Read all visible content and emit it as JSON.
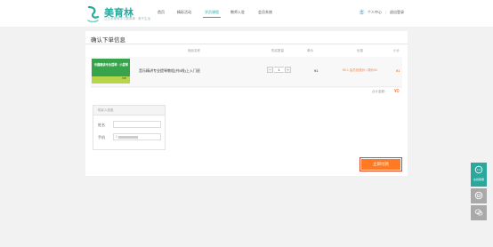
{
  "brand": {
    "name": "美育林",
    "slogan": "让艺术美育学习更简单 · 美于生活",
    "accent": "#2aa89e"
  },
  "nav": {
    "items": [
      {
        "label": "首页",
        "active": false
      },
      {
        "label": "精彩活动",
        "active": false
      },
      {
        "label": "学员课程",
        "active": true
      },
      {
        "label": "教师入驻",
        "active": false
      },
      {
        "label": "会员系统",
        "active": false
      }
    ]
  },
  "user": {
    "center": "个人中心",
    "separator": "|",
    "logout": "退出登录"
  },
  "order": {
    "title": "确认下单信息",
    "headers": {
      "name": "商品名称",
      "quantity": "购买数量",
      "unit_price": "单价",
      "discount": "优惠",
      "subtotal": "小计"
    },
    "item": {
      "image_text": "乐趣精讲专业提琴 · 小提琴",
      "image_badge": "VIP",
      "name": "音乐精讲专业提琴教程(共5线)上入门班",
      "quantity": "1",
      "minus": "−",
      "plus": "+",
      "unit_price": "¥1",
      "discount": "¥0.1 会员优惠价 / 原价¥1",
      "subtotal": "¥1"
    },
    "total_label": "合计金额：",
    "total_value": "¥0"
  },
  "buyer": {
    "title": "购买人信息",
    "name_label": "姓名",
    "name_value": "",
    "phone_label": "手机",
    "phone_value": "1"
  },
  "submit_label": "立即付款",
  "side_tools": {
    "service_label": "在线客服",
    "icons": [
      "chat-icon",
      "cart-icon",
      "wechat-icon"
    ]
  }
}
